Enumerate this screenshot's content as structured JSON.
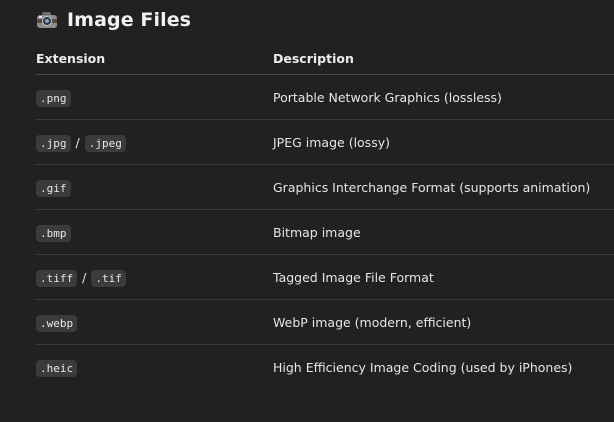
{
  "heading": {
    "icon": "camera-icon",
    "title": "Image Files"
  },
  "table": {
    "headers": [
      "Extension",
      "Description"
    ],
    "rows": [
      {
        "extensions": [
          ".png"
        ],
        "description": "Portable Network Graphics (lossless)"
      },
      {
        "extensions": [
          ".jpg",
          ".jpeg"
        ],
        "separator": "/",
        "description": "JPEG image (lossy)"
      },
      {
        "extensions": [
          ".gif"
        ],
        "description": "Graphics Interchange Format (supports animation)"
      },
      {
        "extensions": [
          ".bmp"
        ],
        "description": "Bitmap image"
      },
      {
        "extensions": [
          ".tiff",
          ".tif"
        ],
        "separator": "/",
        "description": "Tagged Image File Format"
      },
      {
        "extensions": [
          ".webp"
        ],
        "description": "WebP image (modern, efficient)"
      },
      {
        "extensions": [
          ".heic"
        ],
        "description": "High Efficiency Image Coding (used by iPhones)"
      }
    ]
  }
}
